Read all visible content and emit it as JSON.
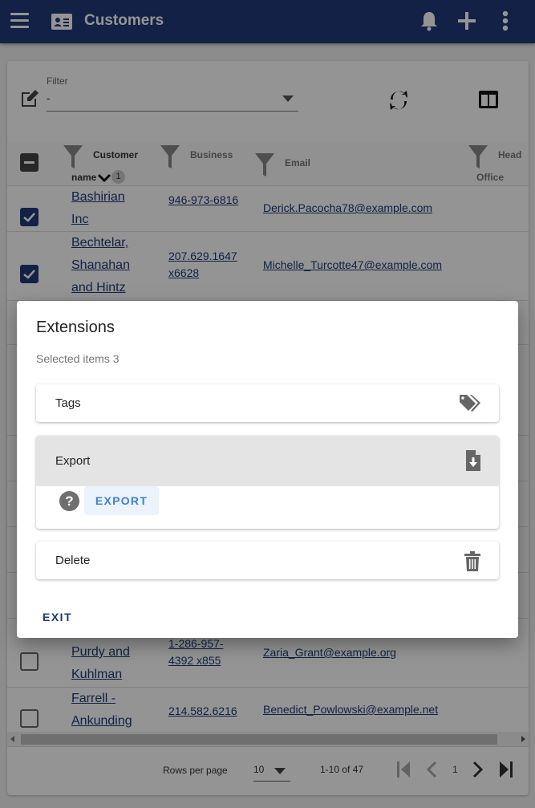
{
  "appbar": {
    "title": "Customers",
    "icons": [
      "menu-icon",
      "contact-card-icon",
      "bell-icon",
      "plus-icon",
      "more-vert-icon"
    ]
  },
  "toolbar": {
    "filter_label": "Filter",
    "filter_value": "-",
    "icons": [
      "edit-icon",
      "refresh-icon",
      "columns-icon"
    ]
  },
  "table": {
    "columns": [
      {
        "label_line1": "Customer",
        "label_line2": "name",
        "sort": "desc",
        "sort_order": "1"
      },
      {
        "label_line1": "Business",
        "label_line2": ""
      },
      {
        "label_line1": "Email",
        "label_line2": ""
      },
      {
        "label_line1": "Head",
        "label_line2": "Office"
      }
    ],
    "rows": [
      {
        "checked": true,
        "name": "Bashirian Inc",
        "phone": "946-973-6816",
        "email": "Derick.Pacocha78@example.com"
      },
      {
        "checked": true,
        "name": "Bechtelar, Shanahan and Hintz",
        "phone": "207.629.1647 x6628",
        "email": "Michelle_Turcotte47@example.com"
      },
      {
        "checked": false,
        "name": "Purdy and Kuhlman",
        "phone": "1-286-957-4392 x855",
        "email": "Zaria_Grant@example.org"
      },
      {
        "checked": false,
        "name": "Farrell - Ankunding",
        "phone": "214.582.6216",
        "email": "Benedict_Powlowski@example.net"
      }
    ]
  },
  "pagination": {
    "rows_per_page_label": "Rows per page",
    "rows_per_page": "10",
    "range": "1-10 of 47",
    "page": "1"
  },
  "dialog": {
    "title": "Extensions",
    "subtitle": "Selected items 3",
    "extensions": [
      {
        "label": "Tags",
        "icon": "tags-icon",
        "expanded": false
      },
      {
        "label": "Export",
        "icon": "file-download-icon",
        "expanded": true,
        "action_label": "EXPORT"
      },
      {
        "label": "Delete",
        "icon": "trash-icon",
        "expanded": false
      }
    ],
    "exit_label": "EXIT"
  },
  "colors": {
    "primary": "#1f3a78",
    "accent": "#3b82d4"
  }
}
